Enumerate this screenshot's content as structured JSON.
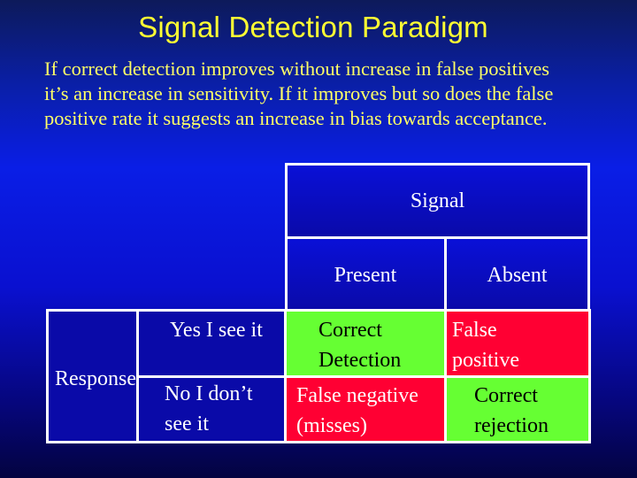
{
  "slide": {
    "title": "Signal Detection Paradigm",
    "body_lines": [
      "If correct detection improves without increase in false positives",
      "it’s an increase in sensitivity.  If it improves but so does the false",
      "positive rate it suggests an increase in bias towards acceptance."
    ]
  },
  "table": {
    "signal_header": "Signal",
    "columns": [
      "Present",
      "Absent"
    ],
    "row_group_label": "Response",
    "rows": [
      {
        "label_lines": [
          "Yes I see it"
        ],
        "cells": [
          {
            "lines": [
              "Correct",
              "Detection"
            ],
            "color": "#66ff33"
          },
          {
            "lines": [
              "False",
              "positive"
            ],
            "color": "#ff0033"
          }
        ]
      },
      {
        "label_lines": [
          "No I don’t",
          "see it"
        ],
        "cells": [
          {
            "lines": [
              "False negative",
              "(misses)"
            ],
            "color": "#ff0033"
          },
          {
            "lines": [
              "Correct",
              "rejection"
            ],
            "color": "#66ff33"
          }
        ]
      }
    ]
  },
  "colors": {
    "title": "#ffff33",
    "body_text": "#ffff66",
    "hit_cell": "#66ff33",
    "error_cell": "#ff0033",
    "header_cell": "#0a10d8"
  }
}
